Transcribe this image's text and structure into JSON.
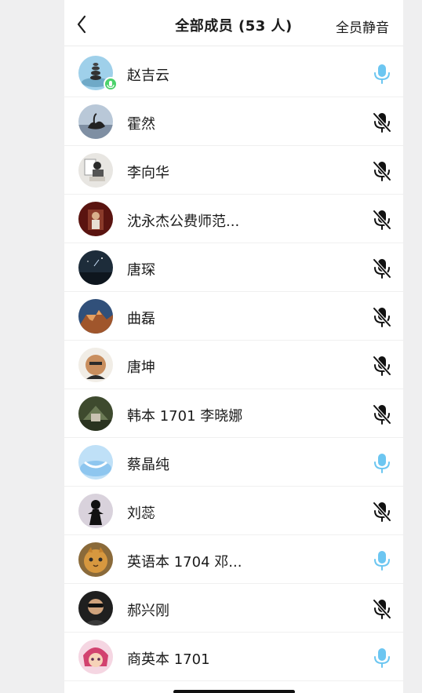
{
  "header": {
    "title": "全部成员 (53 人)",
    "mute_all_label": "全员静音",
    "back_icon": "chevron-left-icon"
  },
  "colors": {
    "mic_on": "#6cc6f1",
    "mic_off": "#111111",
    "speaking_badge": "#4cd26b"
  },
  "members": [
    {
      "name": "赵吉云",
      "mic": "on",
      "speaking": true
    },
    {
      "name": "霍然",
      "mic": "off",
      "speaking": false
    },
    {
      "name": "李向华",
      "mic": "off",
      "speaking": false
    },
    {
      "name": "沈永杰公费师范...",
      "mic": "off",
      "speaking": false
    },
    {
      "name": "唐琛",
      "mic": "off",
      "speaking": false
    },
    {
      "name": "曲磊",
      "mic": "off",
      "speaking": false
    },
    {
      "name": "唐坤",
      "mic": "off",
      "speaking": false
    },
    {
      "name": "韩本 1701 李晓娜",
      "mic": "off",
      "speaking": false
    },
    {
      "name": "蔡晶纯",
      "mic": "on",
      "speaking": false
    },
    {
      "name": "刘蕊",
      "mic": "off",
      "speaking": false
    },
    {
      "name": "英语本 1704 邓...",
      "mic": "on",
      "speaking": false
    },
    {
      "name": "郝兴刚",
      "mic": "off",
      "speaking": false
    },
    {
      "name": "商英本 1701",
      "mic": "on",
      "speaking": false
    }
  ]
}
